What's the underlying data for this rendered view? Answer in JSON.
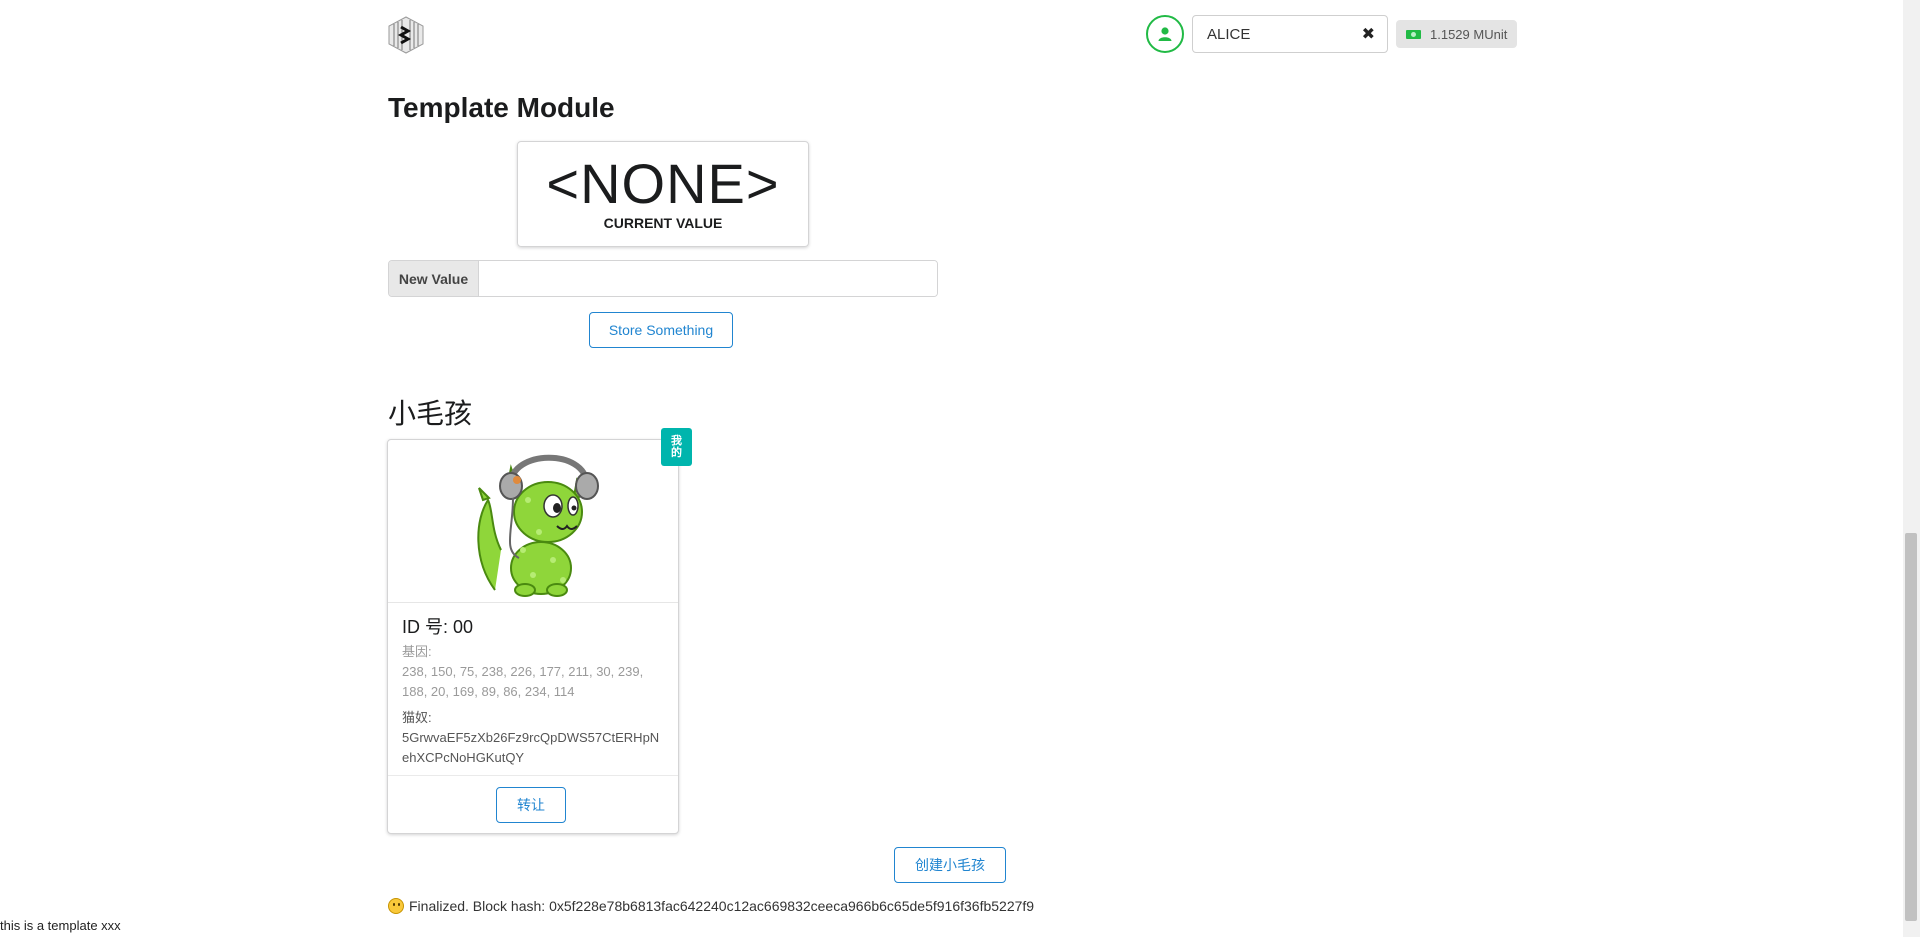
{
  "header": {
    "logo_icon": "substrate-logo-icon",
    "account": {
      "avatar_icon": "user-icon",
      "selected": "ALICE",
      "clear_icon": "close-icon",
      "balance_icon": "money-icon",
      "balance": "1.1529 MUnit"
    }
  },
  "template_module": {
    "title": "Template Module",
    "current_value": "<NONE>",
    "current_value_label": "CURRENT VALUE",
    "input_label": "New Value",
    "input_value": "",
    "store_button": "Store Something"
  },
  "kitties": {
    "title": "小毛孩",
    "items": [
      {
        "ribbon": [
          "我",
          "的"
        ],
        "id_label": "ID 号: 00",
        "dna_label": "基因:",
        "dna": "238, 150, 75, 238, 226, 177, 211, 30, 239, 188, 20, 169, 89, 86, 234, 114",
        "owner_label": "猫奴:",
        "owner": "5GrwvaEF5zXb26Fz9rcQpDWS57CtERHpNehXCPcNoHGKutQY",
        "transfer_button": "转让"
      }
    ],
    "create_button": "创建小毛孩"
  },
  "status": {
    "icon": "smile-emoji-icon",
    "text": "Finalized. Block hash: 0x5f228e78b6813fac642240c12ac669832ceeca966b6c65de5f916f36fb5227f9"
  },
  "footer": {
    "text": "this is a template xxx"
  },
  "colors": {
    "primary": "#2185d0",
    "positive": "#21ba45",
    "ribbon": "#00b5ad"
  }
}
